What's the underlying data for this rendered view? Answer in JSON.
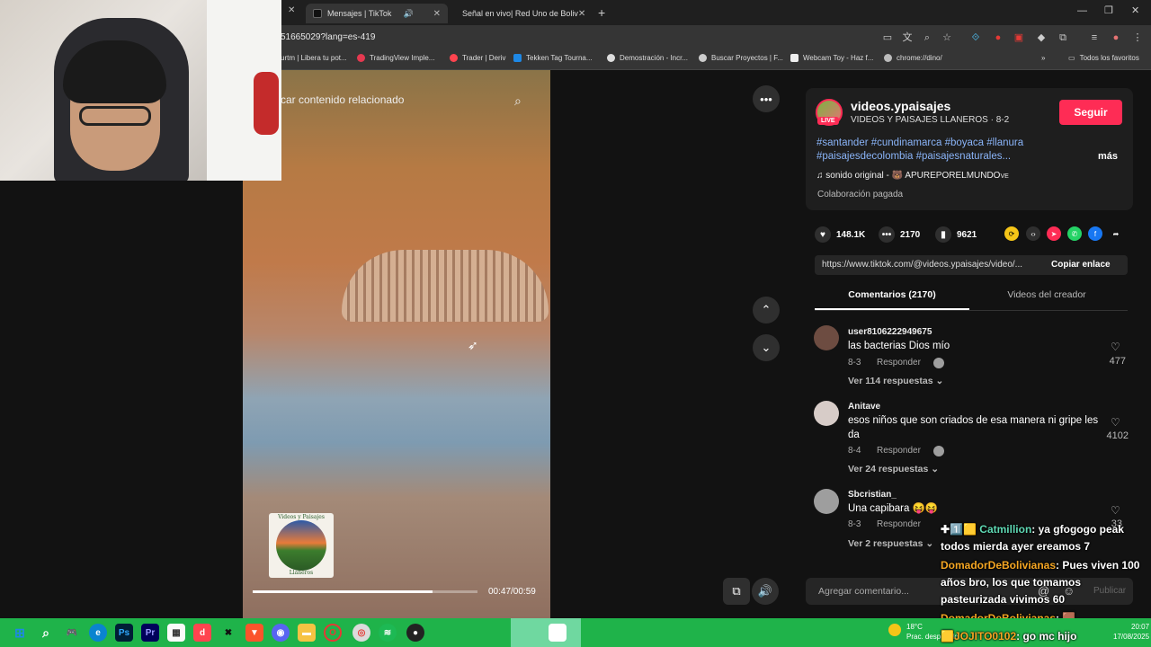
{
  "browser": {
    "tabs": [
      {
        "label": "Mensajes | TikTok",
        "favicon_color": "#111111"
      },
      {
        "label": "Señal en vivo| Red Uno de Boliv",
        "favicon_color": "#e53935"
      }
    ],
    "url": "51665029?lang=es-419",
    "bookmarks": [
      {
        "label": "urtm | Libera tu pot...",
        "color": "#cccccc"
      },
      {
        "label": "TradingView Imple...",
        "color": "#e53950"
      },
      {
        "label": "Trader | Deriv",
        "color": "#ff444f"
      },
      {
        "label": "Tekken Tag Tourna...",
        "color": "#1e88e5"
      },
      {
        "label": "Demostración - Incr...",
        "color": "#dddddd"
      },
      {
        "label": "Buscar Proyectos | F...",
        "color": "#cccccc"
      },
      {
        "label": "Webcam Toy - Haz f...",
        "color": "#eeeeee"
      },
      {
        "label": "chrome://dino/",
        "color": "#bbbbbb"
      }
    ],
    "all_bookmarks": "Todos los favoritos"
  },
  "video": {
    "search_placeholder": "car contenido relacionado",
    "time": "00:47/00:59",
    "progress": 0.8,
    "logo_top": "Videos y Paisajes",
    "logo_bottom": "Llaneros"
  },
  "creator": {
    "username": "videos.ypaisajes",
    "subtitle": "VIDEOS Y PAISAJES LLANEROS · 8-2",
    "live_badge": "LIVE",
    "follow_label": "Seguir",
    "hashtags": "#santander #cundinamarca #boyaca #llanura #paisajesdecolombia #paisajesnaturales...",
    "more_label": "más",
    "sound": "sonido original - 🐻 APUREPORELMUNDO",
    "sound_suffix": "VE",
    "paid": "Colaboración pagada"
  },
  "stats": {
    "likes": "148.1K",
    "comments": "2170",
    "saves": "9621"
  },
  "link": {
    "url": "https://www.tiktok.com/@videos.ypaisajes/video/...",
    "copy_label": "Copiar enlace"
  },
  "tabs": {
    "comments": "Comentarios (2170)",
    "creator": "Videos del creador"
  },
  "comments": [
    {
      "user": "user8106222949675",
      "text": "las bacterias Dios mío",
      "date": "8-3",
      "reply": "Responder",
      "likes": "477",
      "view_replies": "Ver 114 respuestas",
      "avatar_color": "#6d4c41"
    },
    {
      "user": "Anitave",
      "text": "esos niños que son criados de esa manera ni gripe les da",
      "date": "8-4",
      "reply": "Responder",
      "likes": "4102",
      "view_replies": "Ver 24 respuestas",
      "avatar_color": "#d7ccc8"
    },
    {
      "user": "Sbcristian_",
      "text": "Una capibara 😝😝",
      "date": "8-3",
      "reply": "Responder",
      "likes": "33",
      "view_replies": "Ver 2 respuestas",
      "avatar_color": "#9e9e9e"
    }
  ],
  "comment_input": {
    "placeholder": "Agregar comentario...",
    "publish": "Publicar"
  },
  "chat": [
    {
      "prefix": "✚1️⃣🟨 ",
      "name": "Catmillion",
      "text": ": ya gfogogo peak todos mierda ayer ereamos 7"
    },
    {
      "prefix": "",
      "name": "DomadorDeBolivianas",
      "text": ": Pues viven 100 años bro, los que tomamos pasteurizada vivimos 60"
    },
    {
      "prefix": "",
      "name": "DomadorDeBolivianas",
      "text": ": 🟫"
    },
    {
      "prefix": "🟨",
      "name": "JOJITO0102",
      "text": ": go mc hijo"
    }
  ],
  "taskbar": {
    "temp": "18°C",
    "weather": "Prac. despejado",
    "time": "20:07",
    "date": "17/08/2025"
  }
}
